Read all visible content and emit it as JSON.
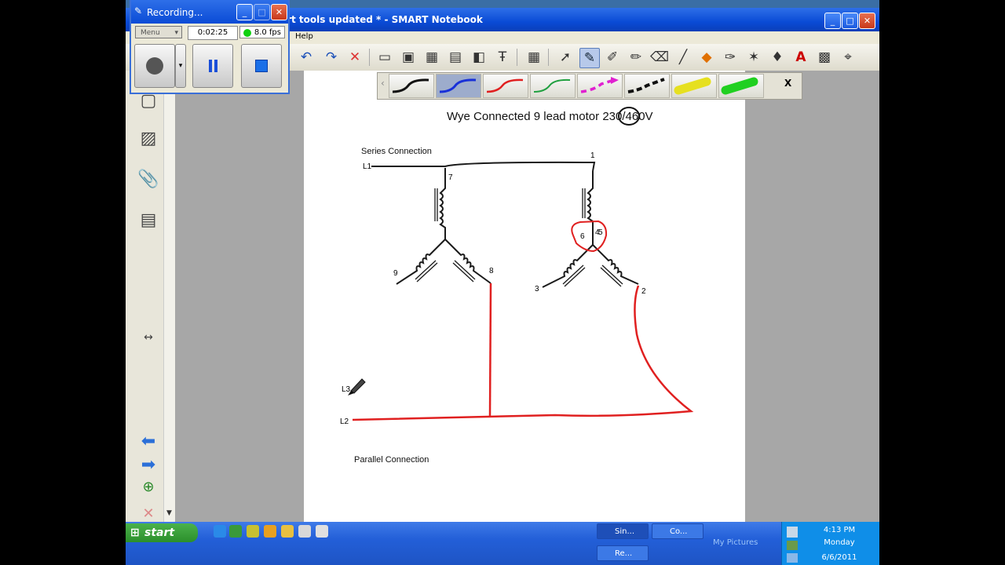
{
  "window": {
    "title": "art tools updated * - SMART Notebook"
  },
  "menubar": {
    "items": [
      "Help"
    ]
  },
  "recorder": {
    "title": "Recording...",
    "menu_label": "Menu",
    "elapsed": "0:02:25",
    "fps": "8.0 fps"
  },
  "page": {
    "heading_part1": "Wye Connected 9 lead motor ",
    "heading_circled": "230",
    "heading_part2": "/460V",
    "series_label": "Series Connection",
    "parallel_label": "Parallel Connection",
    "terminals": {
      "l1": "L1",
      "l2": "L2",
      "l3": "L3",
      "t1": "1",
      "t2": "2",
      "t3": "3",
      "t4": "4",
      "t5": "5",
      "t6": "6",
      "t7": "7",
      "t8": "8",
      "t9": "9"
    }
  },
  "penbar": {
    "close": "X",
    "scroll_left": "‹"
  },
  "taskbar": {
    "start_label": "start",
    "tasks": [
      "Sin...",
      "Co...",
      "Re..."
    ],
    "my_pictures": "My Pictures",
    "clock": {
      "time": "4:13 PM",
      "day": "Monday",
      "date": "6/6/2011"
    }
  },
  "colors": {
    "ink_black": "#1a1a1a",
    "ink_red": "#e02020",
    "title_blue": "#0a4bd6"
  }
}
